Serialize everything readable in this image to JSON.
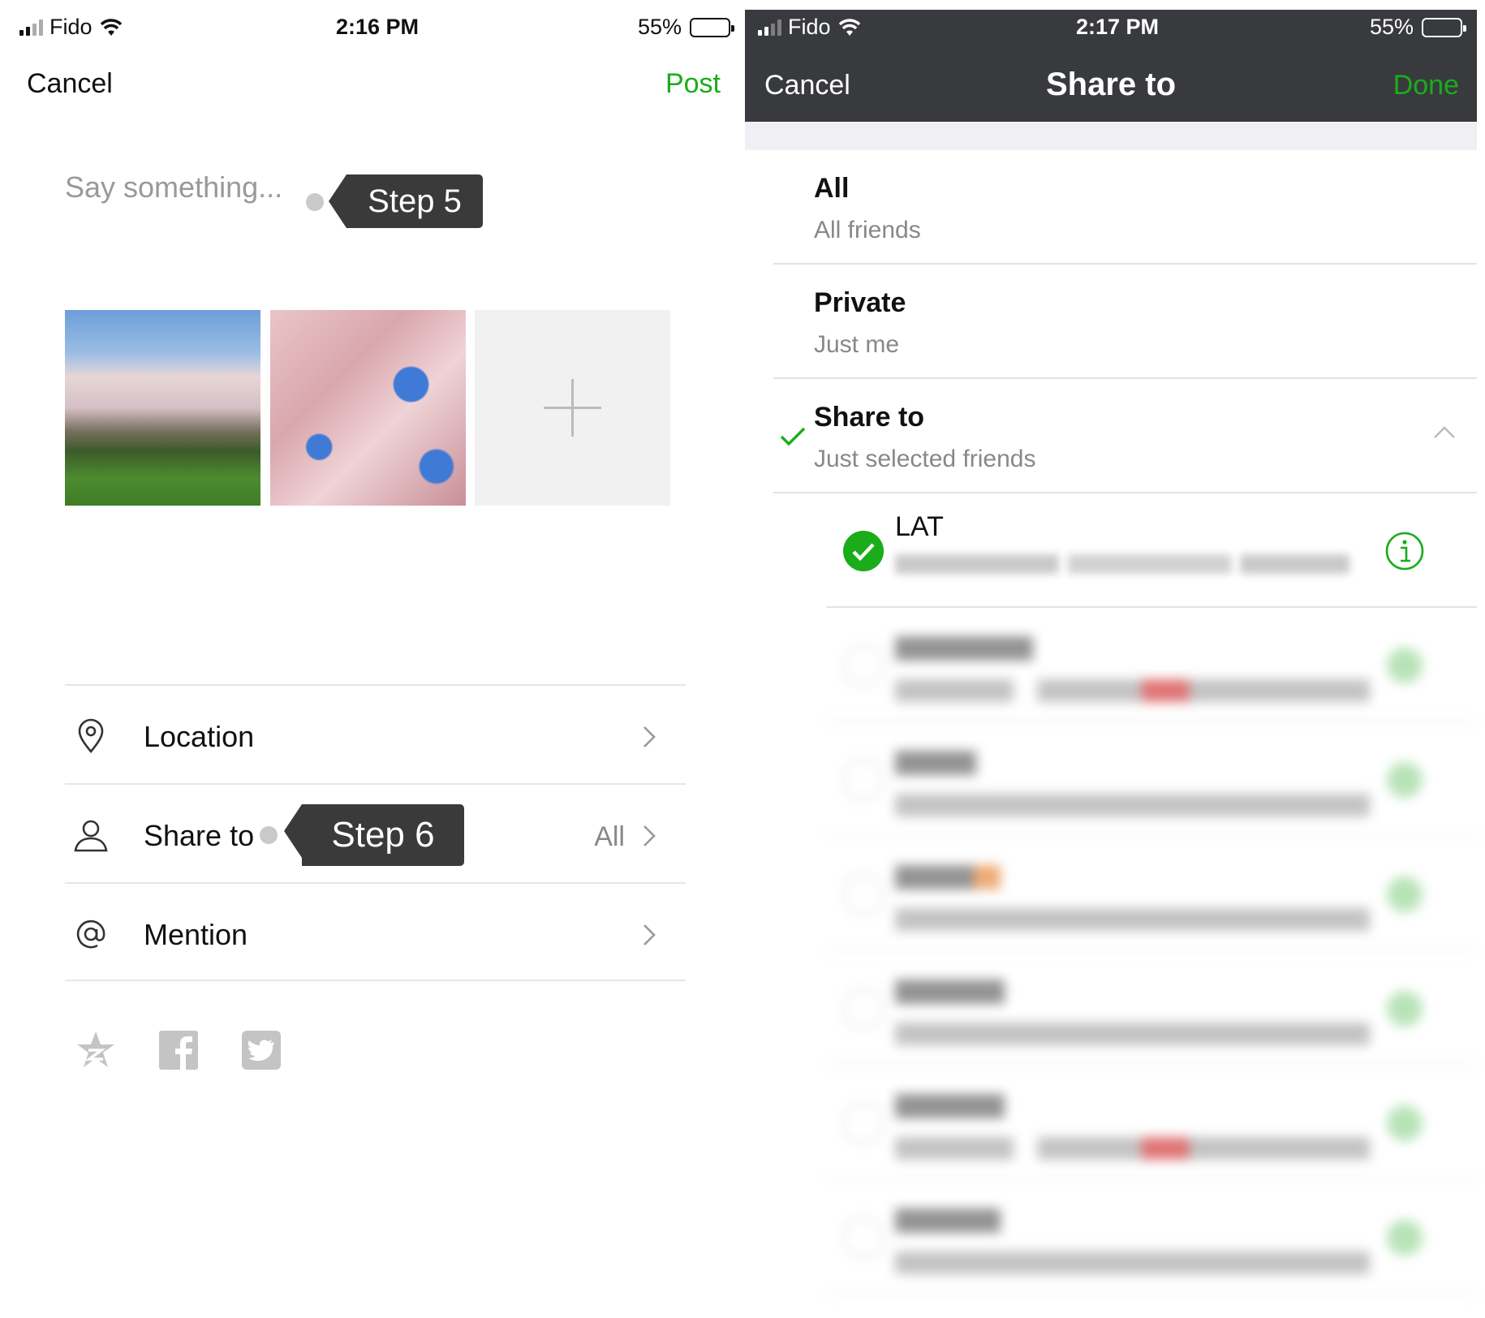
{
  "left_screen": {
    "status_bar": {
      "carrier": "Fido",
      "time": "2:16 PM",
      "battery_percent": "55%",
      "battery_level": 0.55
    },
    "nav": {
      "cancel": "Cancel",
      "post": "Post"
    },
    "compose_placeholder": "Say something...",
    "step5_label": "Step 5",
    "step6_label": "Step 6",
    "options": [
      {
        "label": "Location",
        "value": "",
        "icon": "location-pin-icon"
      },
      {
        "label": "Share to",
        "value": "All",
        "icon": "person-icon"
      },
      {
        "label": "Mention",
        "value": "",
        "icon": "at-sign-icon"
      }
    ],
    "social_icons": [
      "qzone-star-icon",
      "facebook-icon",
      "twitter-icon"
    ],
    "colors": {
      "accent": "#1aad19",
      "tag_bg": "#3a3a3a"
    }
  },
  "right_screen": {
    "status_bar": {
      "carrier": "Fido",
      "time": "2:17 PM",
      "battery_percent": "55%",
      "battery_level": 0.55
    },
    "nav": {
      "cancel": "Cancel",
      "title": "Share to",
      "done": "Done"
    },
    "visibility_options": [
      {
        "title": "All",
        "subtitle": "All friends",
        "selected": false
      },
      {
        "title": "Private",
        "subtitle": "Just me",
        "selected": false
      },
      {
        "title": "Share to",
        "subtitle": "Just selected friends",
        "selected": true
      }
    ],
    "tag_groups": [
      {
        "name": "LAT",
        "members": "",
        "selected": true
      },
      {
        "name": "",
        "members": "",
        "selected": false
      },
      {
        "name": "",
        "members": "",
        "selected": false
      },
      {
        "name": "",
        "members": "",
        "selected": false
      },
      {
        "name": "",
        "members": "",
        "selected": false
      },
      {
        "name": "",
        "members": "",
        "selected": false
      },
      {
        "name": "",
        "members": "",
        "selected": false
      }
    ],
    "colors": {
      "header_bg": "#393a3e",
      "accent": "#1aad19"
    }
  }
}
